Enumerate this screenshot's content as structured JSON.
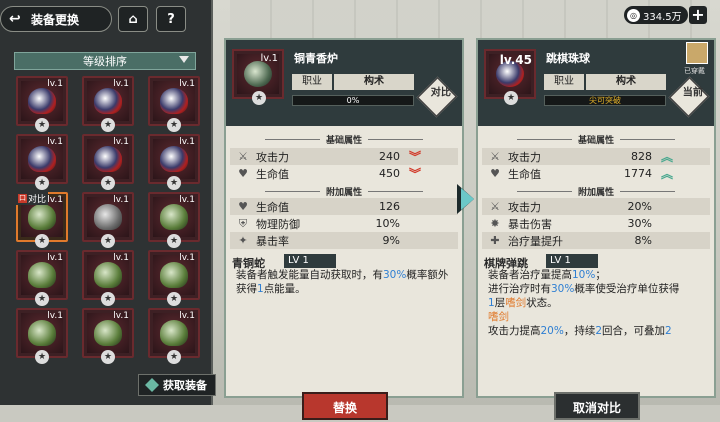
{
  "header": {
    "title": "装备更换",
    "home_label": "⌂",
    "help_label": "?"
  },
  "currency": {
    "amount": "334.5万",
    "add_label": "+"
  },
  "sort": {
    "label": "等级排序"
  },
  "grid": {
    "items": [
      {
        "lv": "lv.1",
        "kind": "red"
      },
      {
        "lv": "lv.1",
        "kind": "red"
      },
      {
        "lv": "lv.1",
        "kind": "red"
      },
      {
        "lv": "lv.1",
        "kind": "red"
      },
      {
        "lv": "lv.1",
        "kind": "red"
      },
      {
        "lv": "lv.1",
        "kind": "red"
      },
      {
        "lv": "lv.1",
        "kind": "green",
        "compare": "对比"
      },
      {
        "lv": "lv.1",
        "kind": "gray"
      },
      {
        "lv": "lv.1",
        "kind": "green"
      },
      {
        "lv": "lv.1",
        "kind": "green"
      },
      {
        "lv": "lv.1",
        "kind": "green"
      },
      {
        "lv": "lv.1",
        "kind": "green"
      },
      {
        "lv": "lv.1",
        "kind": "green"
      },
      {
        "lv": "lv.1",
        "kind": "green"
      },
      {
        "lv": "lv.1",
        "kind": "green"
      }
    ],
    "star": "★"
  },
  "obtain": {
    "label": "获取装备"
  },
  "left_item": {
    "name": "铜青香炉",
    "lv": "lv.1",
    "job_label": "职业",
    "job": "构术",
    "progress": "0%",
    "progress_value": 0,
    "tag": "对比",
    "base_title": "基础属性",
    "base": [
      {
        "icon": "sword-icon",
        "label": "攻击力",
        "value": "240",
        "change": "down"
      },
      {
        "icon": "heart-icon",
        "label": "生命值",
        "value": "450",
        "change": "down"
      }
    ],
    "extra_title": "附加属性",
    "extra": [
      {
        "icon": "heart-icon",
        "label": "生命值",
        "value": "126"
      },
      {
        "icon": "shield-icon",
        "label": "物理防御",
        "value": "10%"
      },
      {
        "icon": "crit-icon",
        "label": "暴击率",
        "value": "9%"
      }
    ],
    "skill": {
      "name": "青铜蛇",
      "lv": "LV 1",
      "desc_1": "装备者触发能量自动获取时，有",
      "desc_hl": "30%",
      "desc_2": "概率额外获得",
      "desc_num": "1",
      "desc_3": "点能量。"
    },
    "button": "替换"
  },
  "right_item": {
    "name": "跳棋珠球",
    "lv": "lv.45",
    "job_label": "职业",
    "job": "构术",
    "progress": "尖可突破",
    "tag": "当前",
    "equipped": "已穿戴",
    "base_title": "基础属性",
    "base": [
      {
        "icon": "sword-icon",
        "label": "攻击力",
        "value": "828",
        "change": "up"
      },
      {
        "icon": "heart-icon",
        "label": "生命值",
        "value": "1774",
        "change": "up"
      }
    ],
    "extra_title": "附加属性",
    "extra": [
      {
        "icon": "sword-icon",
        "label": "攻击力",
        "value": "20%"
      },
      {
        "icon": "burst-icon",
        "label": "暴击伤害",
        "value": "30%"
      },
      {
        "icon": "heal-icon",
        "label": "治疗量提升",
        "value": "8%"
      }
    ],
    "skill": {
      "name": "棋牌弹跳",
      "lv": "LV 1",
      "l1a": "装备者治疗量提高",
      "l1b": "10%",
      "l1c": "；",
      "l2a": "进行治疗时有",
      "l2b": "30%",
      "l2c": "概率使受治疗单位获得",
      "l3a": "1",
      "l3b": "层",
      "l3c": "嗜剑",
      "l3d": "状态。",
      "l4": "嗜剑",
      "l5a": "攻击力提高",
      "l5b": "20%",
      "l5c": "，持续",
      "l5d": "2",
      "l5e": "回合，可叠加",
      "l5f": "2"
    },
    "button": "取消对比"
  },
  "colors": {
    "accent": "#4aa88f",
    "danger": "#d23a2a",
    "highlight": "#2f7fd2",
    "orange": "#e07a2c",
    "btn_red": "#b8372d",
    "btn_dark": "#2b2f30"
  }
}
